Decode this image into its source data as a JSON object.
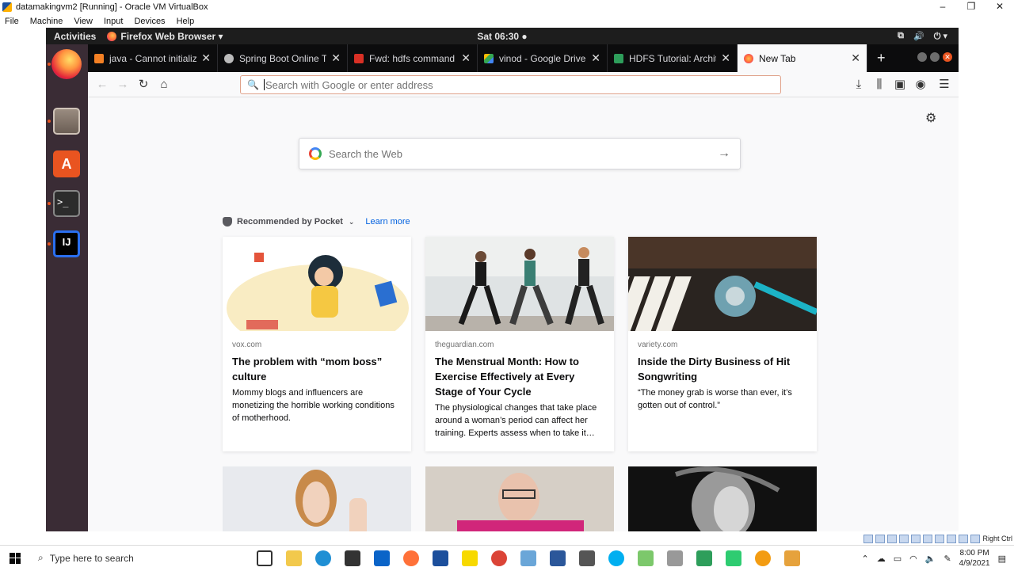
{
  "vbox": {
    "title": "datamakingvm2 [Running] - Oracle VM VirtualBox",
    "menu": [
      "File",
      "Machine",
      "View",
      "Input",
      "Devices",
      "Help"
    ],
    "host_key": "Right Ctrl"
  },
  "gnome": {
    "activities": "Activities",
    "app_menu": "Firefox Web Browser ▾",
    "clock": "Sat 06:30 ●"
  },
  "browser": {
    "tabs": [
      {
        "title": "java - Cannot initializ",
        "icon": "stackoverflow-icon",
        "color": "#f48024"
      },
      {
        "title": "Spring Boot Online T",
        "icon": "globe-icon",
        "color": "#bbbbbb"
      },
      {
        "title": "Fwd: hdfs command",
        "icon": "gmail-icon",
        "color": "#d93025"
      },
      {
        "title": "vinod - Google Drive",
        "icon": "google-drive-icon",
        "color": "#34a853"
      },
      {
        "title": "HDFS Tutorial: Archit",
        "icon": "document-icon",
        "color": "#2e9e5b"
      },
      {
        "title": "New Tab",
        "icon": "firefox-icon",
        "color": "#ff7139"
      }
    ],
    "url_placeholder": "Search with Google or enter address"
  },
  "newtab": {
    "search_placeholder": "Search the Web",
    "pocket_label": "Recommended by Pocket",
    "learn_more": "Learn more",
    "cards": [
      {
        "source": "vox.com",
        "title": "The problem with “mom boss” culture",
        "desc": "Mommy blogs and influencers are monetizing the horrible working conditions of motherhood."
      },
      {
        "source": "theguardian.com",
        "title": "The Menstrual Month: How to Exercise Effectively at Every Stage of Your Cycle",
        "desc": "The physiological changes that take place around a woman’s period can affect her training. Experts assess when to take it…"
      },
      {
        "source": "variety.com",
        "title": "Inside the Dirty Business of Hit Songwriting",
        "desc": "“The money grab is worse than ever, it’s gotten out of control.”"
      }
    ]
  },
  "taskbar": {
    "search_placeholder": "Type here to search",
    "time": "8:00 PM",
    "date": "4/9/2021"
  }
}
